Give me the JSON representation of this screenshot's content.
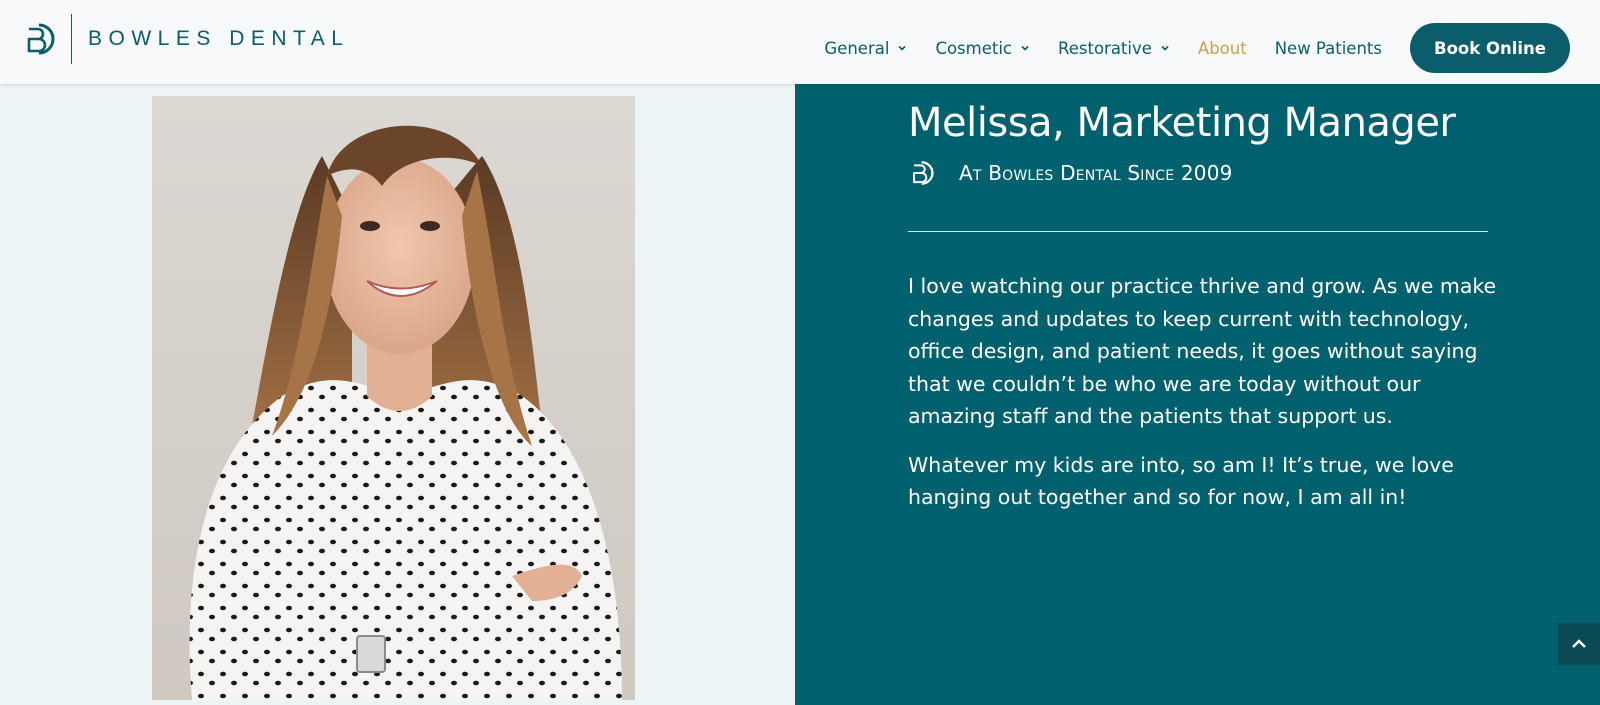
{
  "brand": {
    "name": "BOWLES DENTAL",
    "primary_color": "#0b5d6c",
    "accent_color": "#c9a24e",
    "panel_color": "#00606d"
  },
  "nav": {
    "items": [
      {
        "label": "General",
        "has_dropdown": true,
        "active": false
      },
      {
        "label": "Cosmetic",
        "has_dropdown": true,
        "active": false
      },
      {
        "label": "Restorative",
        "has_dropdown": true,
        "active": false
      },
      {
        "label": "About",
        "has_dropdown": false,
        "active": true
      },
      {
        "label": "New Patients",
        "has_dropdown": false,
        "active": false
      }
    ],
    "cta_label": "Book Online"
  },
  "profile": {
    "heading": "Melissa, Marketing Manager",
    "since": "At Bowles Dental Since 2009",
    "bio": [
      "I love watching our practice thrive and grow. As we make changes and updates to keep current with technology, office design, and patient needs, it goes without saying that we couldn’t be who we are today without our amazing staff and the patients that support us.",
      "Whatever my kids are into, so am I! It’s true, we love hanging out together and so for now, I am all in!"
    ]
  },
  "icons": {
    "logo": "bd-monogram-icon",
    "since": "bd-monogram-icon",
    "dropdown": "chevron-down-icon",
    "scroll_top": "chevron-up-icon"
  }
}
